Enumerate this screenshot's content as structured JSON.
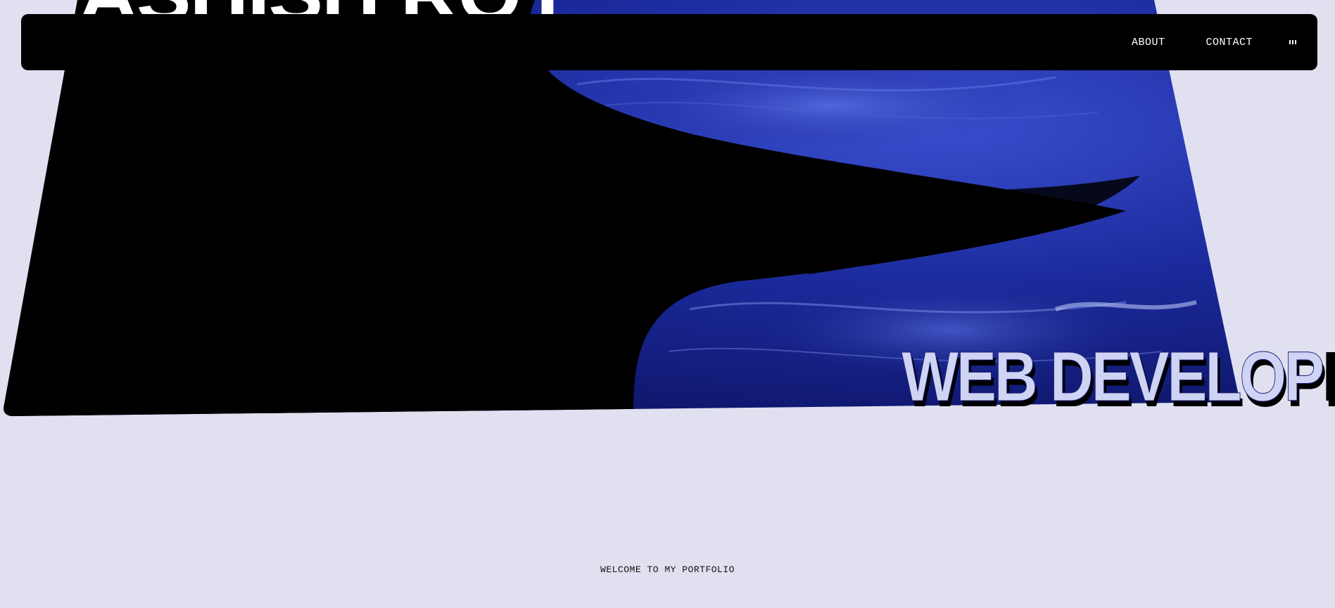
{
  "hero": {
    "name": "ASHISH ROY",
    "role_main": "WEB DEVELOP",
    "role_tail": "ER"
  },
  "nav": {
    "about": "ABOUT",
    "contact": "CONTACT",
    "menu_icon": "menu-bars-icon"
  },
  "welcome": "WELCOME TO MY PORTFOLIO",
  "colors": {
    "background": "#e0e0f0",
    "nav_bg": "#000000",
    "accent_blue": "#1a2a9c",
    "text_light": "#ffffff",
    "role_fill": "#cfd3f4"
  }
}
